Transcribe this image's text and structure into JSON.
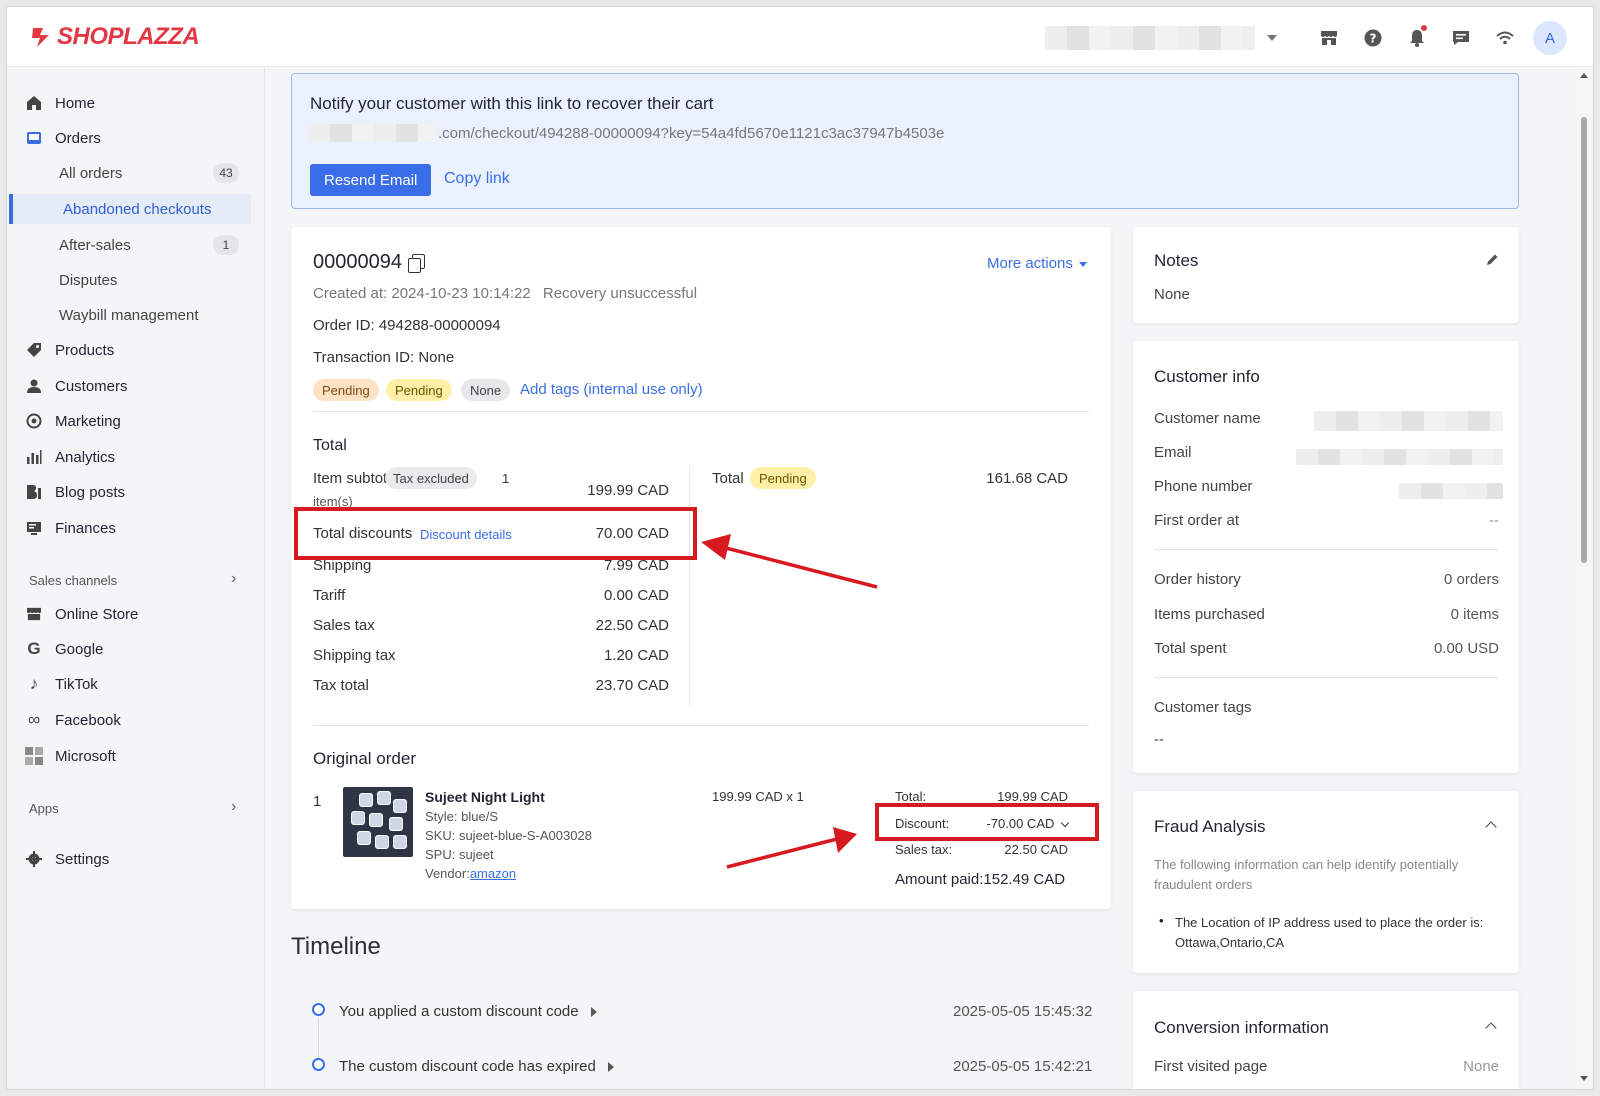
{
  "brand": {
    "name": "SHOPLAZZA",
    "accent": "#e23744",
    "link_color": "#3a6ee8"
  },
  "topbar": {
    "icons": [
      "store-icon",
      "help-icon",
      "bell-icon",
      "message-icon",
      "wifi-icon"
    ],
    "avatar_initial": "A"
  },
  "sidebar": {
    "home": "Home",
    "orders": "Orders",
    "orders_sub": {
      "all_orders": "All orders",
      "all_orders_count": "43",
      "abandoned": "Abandoned checkouts",
      "after_sales": "After-sales",
      "after_sales_count": "1",
      "disputes": "Disputes",
      "waybill": "Waybill management"
    },
    "products": "Products",
    "customers": "Customers",
    "marketing": "Marketing",
    "analytics": "Analytics",
    "blog_posts": "Blog posts",
    "finances": "Finances",
    "sales_channels_label": "Sales channels",
    "online_store": "Online Store",
    "google": "Google",
    "tiktok": "TikTok",
    "facebook": "Facebook",
    "microsoft": "Microsoft",
    "apps_label": "Apps",
    "settings": "Settings"
  },
  "banner": {
    "title": "Notify your customer with this link to recover their cart",
    "link_text": ".com/checkout/494288-00000094?key=54a4fd5670e1121c3ac37947b4503e",
    "resend_label": "Resend Email",
    "copy_label": "Copy link"
  },
  "order": {
    "number": "00000094",
    "more_actions": "More actions",
    "created_label": "Created at:",
    "created_value": "2024-10-23 10:14:22",
    "recovery_status": "Recovery unsuccessful",
    "order_id": "Order ID: 494288-00000094",
    "transaction_id": "Transaction ID: None",
    "tags": [
      "Pending",
      "Pending",
      "None"
    ],
    "add_tags": "Add tags (internal use only)"
  },
  "totals": {
    "title": "Total",
    "item_subtotal_label": "Item subtotal",
    "tax_chip": "Tax excluded",
    "item_count": "1",
    "item_unit": "item(s)",
    "item_subtotal_value": "199.99 CAD",
    "discount_label": "Total discounts",
    "discount_link": "Discount details",
    "discount_value": "70.00 CAD",
    "shipping_label": "Shipping",
    "shipping_value": "7.99 CAD",
    "tariff_label": "Tariff",
    "tariff_value": "0.00 CAD",
    "sales_tax_label": "Sales tax",
    "sales_tax_value": "22.50 CAD",
    "shipping_tax_label": "Shipping tax",
    "shipping_tax_value": "1.20 CAD",
    "tax_total_label": "Tax total",
    "tax_total_value": "23.70 CAD",
    "grand_label": "Total",
    "grand_status": "Pending",
    "grand_value": "161.68 CAD"
  },
  "original_order": {
    "title": "Original order",
    "index": "1",
    "product_name": "Sujeet Night Light",
    "style": "Style: blue/S",
    "sku": "SKU: sujeet-blue-S-A003028",
    "spu": "SPU: sujeet",
    "vendor_label": "Vendor:",
    "vendor_link": "amazon",
    "price_qty": "199.99 CAD x 1",
    "total_label": "Total:",
    "total_value": "199.99 CAD",
    "discount_label": "Discount:",
    "discount_value": "-70.00 CAD",
    "sales_tax_label": "Sales tax:",
    "sales_tax_value": "22.50 CAD",
    "amount_paid": "Amount paid:152.49 CAD"
  },
  "timeline": {
    "title": "Timeline",
    "events": [
      {
        "text": "You applied a custom discount code",
        "time": "2025-05-05 15:45:32"
      },
      {
        "text": "The custom discount code has expired",
        "time": "2025-05-05 15:42:21"
      }
    ]
  },
  "notes": {
    "title": "Notes",
    "value": "None"
  },
  "customer_info": {
    "title": "Customer info",
    "name_label": "Customer name",
    "email_label": "Email",
    "phone_label": "Phone number",
    "first_order_label": "First order at",
    "first_order_value": "--",
    "order_history_label": "Order history",
    "order_history_value": "0 orders",
    "items_purchased_label": "Items purchased",
    "items_purchased_value": "0 items",
    "total_spent_label": "Total spent",
    "total_spent_value": "0.00 USD",
    "tags_label": "Customer tags",
    "tags_value": "--"
  },
  "fraud": {
    "title": "Fraud Analysis",
    "note": "The following information can help identify potentially fraudulent orders",
    "bullet": "The Location of IP address used to place the order is: Ottawa,Ontario,CA"
  },
  "conversion": {
    "title": "Conversion information",
    "first_page_label": "First visited page",
    "first_page_value": "None"
  }
}
